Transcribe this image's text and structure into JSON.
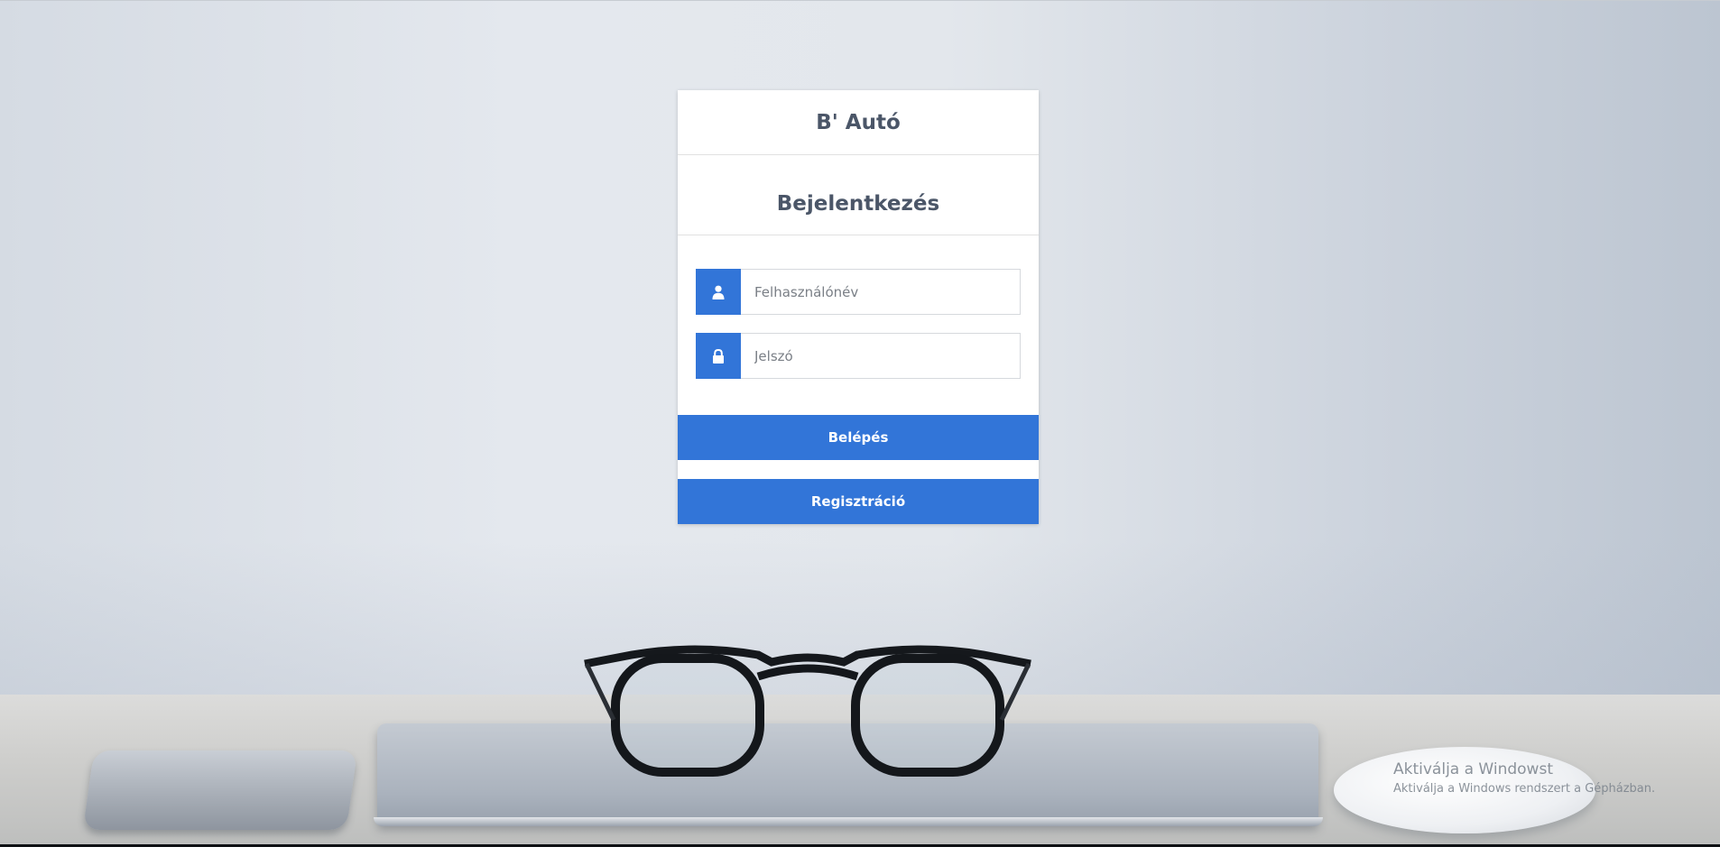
{
  "login_card": {
    "brand": "B' Autó",
    "title": "Bejelentkezés",
    "username_placeholder": "Felhasználónév",
    "password_placeholder": "Jelszó",
    "login_button": "Belépés",
    "register_button": "Regisztráció"
  },
  "icons": {
    "username": "user-icon",
    "password": "lock-icon"
  },
  "colors": {
    "accent": "#3275d8",
    "text": "#4b5668"
  },
  "watermark": {
    "title": "Aktiválja a Windowst",
    "subtitle": "Aktiválja a Windows rendszert a Gépházban."
  }
}
